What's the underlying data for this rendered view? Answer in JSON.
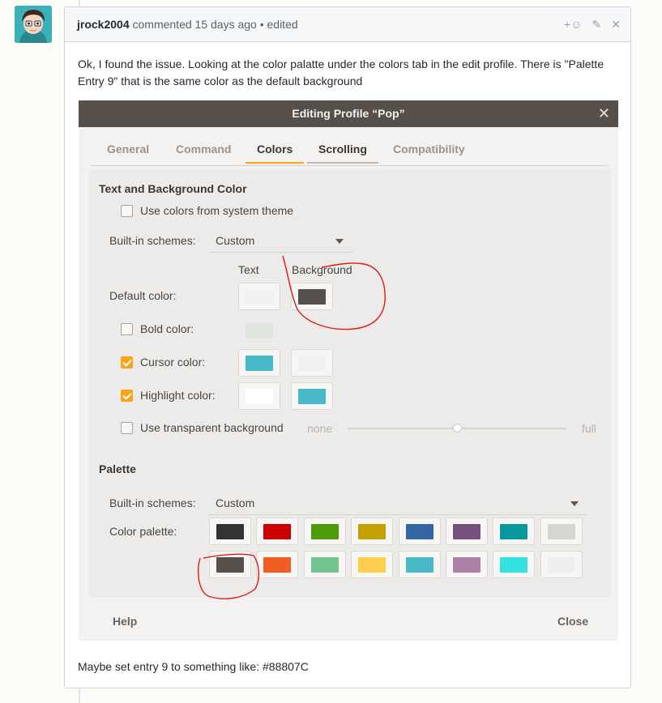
{
  "comment": {
    "author": "jrock2004",
    "meta": "commented 15 days ago • edited",
    "body": "Ok, I found the issue. Looking at the color palatte under the colors tab in the edit profile. There is \"Palette Entry 9\" that is the same color as the default background",
    "footer": "Maybe set entry 9 to something like: #88807C",
    "actions": [
      "+☺",
      "✎",
      "✕"
    ]
  },
  "dialog": {
    "title": "Editing Profile “Pop”",
    "close_glyph": "✕",
    "tabs": [
      "General",
      "Command",
      "Colors",
      "Scrolling",
      "Compatibility"
    ],
    "active_tab": "Colors",
    "text_bg": {
      "heading": "Text and Background Color",
      "use_system_theme": "Use colors from system theme",
      "builtin_label": "Built-in schemes:",
      "builtin_value": "Custom",
      "col_text": "Text",
      "col_background": "Background",
      "default_color": "Default color:",
      "bold_color": "Bold color:",
      "cursor_color": "Cursor color:",
      "highlight_color": "Highlight color:",
      "transparent": "Use transparent background",
      "none": "none",
      "full": "full",
      "transparency_level": 0.5
    },
    "palette": {
      "heading": "Palette",
      "builtin_label": "Built-in schemes:",
      "builtin_value": "Custom",
      "palette_label": "Color palette:",
      "colors": [
        "#333333",
        "#cc0000",
        "#4e9a06",
        "#c4a000",
        "#3465a4",
        "#75507b",
        "#06989a",
        "#d3d7cf",
        "#574f4a",
        "#f15d22",
        "#73c48f",
        "#ffce51",
        "#48b9c7",
        "#ad7fa8",
        "#34e2e2",
        "#eeeeec"
      ]
    },
    "colors": {
      "default_text": "#f2f1f0",
      "default_bg": "#574f4a",
      "bold": "#dfe6e0",
      "cursor": "#48b9c7",
      "cursor_bg": "#f2f1f0",
      "highlight": "#ffffff",
      "highlight_bg": "#48b9c7",
      "accent": "#faa41a"
    },
    "help": "Help",
    "close": "Close"
  }
}
